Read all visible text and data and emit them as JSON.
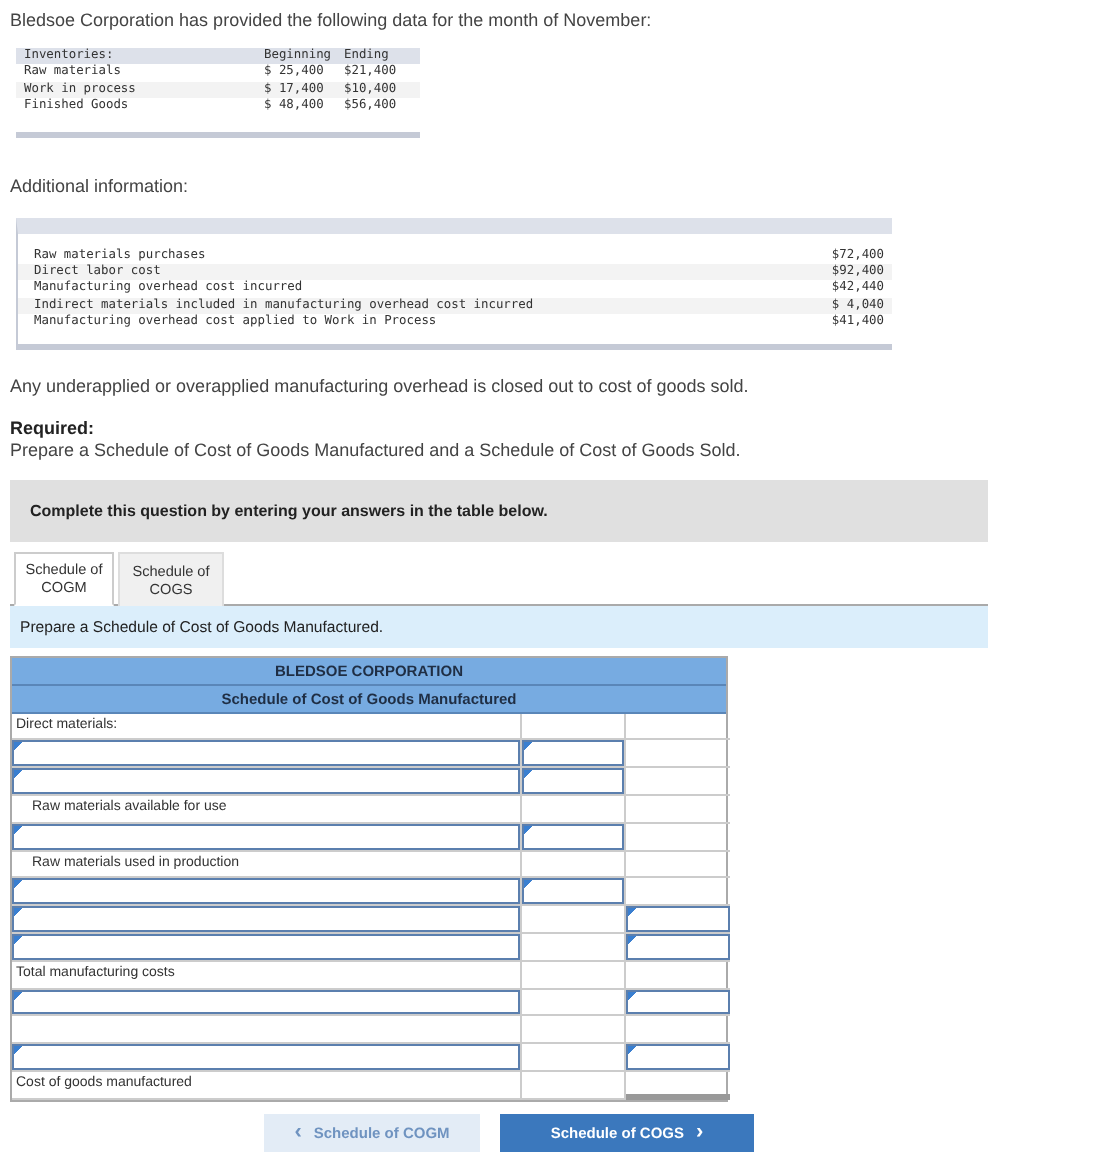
{
  "intro": "Bledsoe Corporation has provided the following data for the month of November:",
  "inventories": {
    "header": [
      "Inventories:",
      "Beginning",
      "Ending"
    ],
    "rows": [
      [
        "Raw materials",
        "$ 25,400",
        "$21,400"
      ],
      [
        "Work in process",
        "$ 17,400",
        "$10,400"
      ],
      [
        "Finished Goods",
        "$ 48,400",
        "$56,400"
      ]
    ]
  },
  "additional_heading": "Additional information:",
  "additional": [
    {
      "label": "Raw materials purchases",
      "value": "$72,400"
    },
    {
      "label": "Direct labor cost",
      "value": "$92,400"
    },
    {
      "label": "Manufacturing overhead cost incurred",
      "value": "$42,440"
    },
    {
      "label": "Indirect materials included in manufacturing overhead cost incurred",
      "value": "$ 4,040"
    },
    {
      "label": "Manufacturing overhead cost applied to Work in Process",
      "value": "$41,400"
    }
  ],
  "note": "Any underapplied or overapplied manufacturing overhead is closed out to cost of goods sold.",
  "required_label": "Required:",
  "required_text": "Prepare a Schedule of Cost of Goods Manufactured and a Schedule of Cost of Goods Sold.",
  "instruction": "Complete this question by entering your answers in the table below.",
  "tabs": [
    {
      "label": "Schedule of COGM",
      "selected": true
    },
    {
      "label": "Schedule of COGS",
      "selected": false
    }
  ],
  "prompt": "Prepare a Schedule of Cost of Goods Manufactured.",
  "schedule": {
    "company": "BLEDSOE CORPORATION",
    "title": "Schedule of Cost of Goods Manufactured",
    "rows": [
      {
        "kind": "label",
        "text": "Direct materials:",
        "indent": false,
        "final": false
      },
      {
        "kind": "entryfirst"
      },
      {
        "kind": "entryfirst"
      },
      {
        "kind": "label",
        "text": "Raw materials available for use",
        "indent": true,
        "final": false
      },
      {
        "kind": "entryfirst"
      },
      {
        "kind": "label",
        "text": "Raw materials used in production",
        "indent": true,
        "final": false
      },
      {
        "kind": "entryfirst"
      },
      {
        "kind": "entrysecond"
      },
      {
        "kind": "entrysecond"
      },
      {
        "kind": "label",
        "text": "Total manufacturing costs",
        "indent": false,
        "final": false
      },
      {
        "kind": "entrysecond"
      },
      {
        "kind": "blank"
      },
      {
        "kind": "entrysecond"
      },
      {
        "kind": "label",
        "text": "Cost of goods manufactured",
        "indent": false,
        "final": true
      }
    ]
  },
  "buttons": [
    {
      "label": "Schedule of COGM",
      "icon_before": "‹",
      "disabled": true
    },
    {
      "label": "Schedule of COGS",
      "icon_after": "›",
      "disabled": false
    }
  ]
}
